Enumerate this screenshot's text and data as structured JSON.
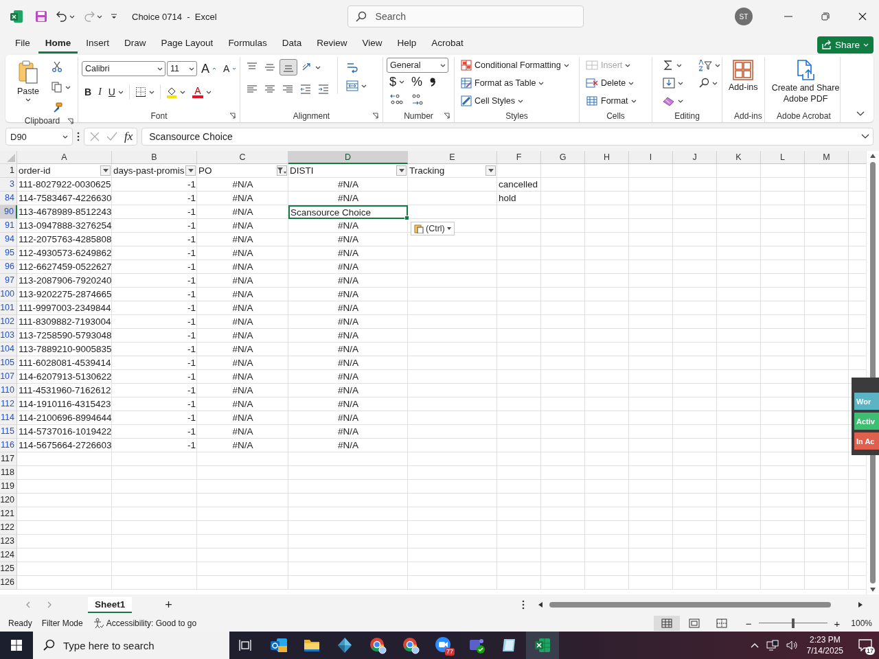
{
  "title_bar": {
    "title": "Choice 0714  -  Excel",
    "redo_disabled": true,
    "search": {
      "placeholder": "Search"
    },
    "avatar": "ST"
  },
  "ribbon_tabs": [
    {
      "label": "File",
      "selected": false
    },
    {
      "label": "Home",
      "selected": true
    },
    {
      "label": "Insert",
      "selected": false
    },
    {
      "label": "Draw",
      "selected": false
    },
    {
      "label": "Page Layout",
      "selected": false
    },
    {
      "label": "Formulas",
      "selected": false
    },
    {
      "label": "Data",
      "selected": false
    },
    {
      "label": "Review",
      "selected": false
    },
    {
      "label": "View",
      "selected": false
    },
    {
      "label": "Help",
      "selected": false
    },
    {
      "label": "Acrobat",
      "selected": false
    }
  ],
  "share_button": "Share",
  "ribbon": {
    "groups": [
      {
        "kind": "clipboard",
        "label": "Clipboard",
        "launcher": true,
        "paste_label": "Paste"
      },
      {
        "kind": "font",
        "label": "Font",
        "launcher": true,
        "font_name": "Calibri",
        "font_size": "11",
        "grow_glyph": "A",
        "shrink_glyph": "A",
        "bold": "B",
        "italic": "I",
        "underline": "U",
        "font_color_glyph": "A"
      },
      {
        "kind": "alignment",
        "label": "Alignment",
        "launcher": true,
        "vertical_align": [
          {
            "selected": false
          },
          {
            "selected": false
          },
          {
            "selected": true
          }
        ]
      },
      {
        "kind": "number",
        "label": "Number",
        "launcher": true,
        "format": "General",
        "currency": "$",
        "percent": "%"
      },
      {
        "kind": "styles",
        "label": "Styles",
        "commands": [
          "Conditional Formatting",
          "Format as Table",
          "Cell Styles"
        ]
      },
      {
        "kind": "cells",
        "label": "Cells",
        "commands": [
          {
            "label": "Insert",
            "disabled": true
          },
          {
            "label": "Delete",
            "disabled": false
          },
          {
            "label": "Format",
            "disabled": false
          }
        ]
      },
      {
        "kind": "editing",
        "label": "Editing"
      },
      {
        "kind": "addins",
        "label": "Add-ins",
        "button": "Add-ins"
      },
      {
        "kind": "acrobat",
        "label": "Adobe Acrobat",
        "button": "Create and Share Adobe PDF"
      }
    ]
  },
  "formula_bar": {
    "name_box": "D90",
    "function_label": "fx",
    "value": "Scansource Choice"
  },
  "sheet": {
    "columns": [
      {
        "label": "A",
        "selected": false
      },
      {
        "label": "B",
        "selected": false
      },
      {
        "label": "C",
        "selected": false
      },
      {
        "label": "D",
        "selected": true
      },
      {
        "label": "E",
        "selected": false
      },
      {
        "label": "F",
        "selected": false
      },
      {
        "label": "G",
        "selected": false
      },
      {
        "label": "H",
        "selected": false
      },
      {
        "label": "I",
        "selected": false
      },
      {
        "label": "J",
        "selected": false
      },
      {
        "label": "K",
        "selected": false
      },
      {
        "label": "L",
        "selected": false
      },
      {
        "label": "M",
        "selected": false
      }
    ],
    "rows": [
      {
        "number": "1",
        "filtered": false,
        "selected": false,
        "cells": {
          "a": {
            "value": "order-id",
            "kind": "text",
            "filter_applied": false
          },
          "b": {
            "value": "days-past-promis",
            "kind": "text",
            "filter_applied": false
          },
          "c": {
            "value": "PO",
            "kind": "text",
            "filter_applied": true
          },
          "d": {
            "value": "DISTI",
            "kind": "text",
            "filter_applied": false
          },
          "e": {
            "value": "Tracking",
            "kind": "text",
            "filter_applied": false
          }
        }
      },
      {
        "number": "3",
        "filtered": true,
        "selected": false,
        "cells": {
          "a": {
            "value": "111-8027922-0030625",
            "kind": "text"
          },
          "b": {
            "value": "-1",
            "kind": "number"
          },
          "c": {
            "value": "#N/A",
            "kind": "error"
          },
          "d": {
            "value": "#N/A",
            "kind": "error"
          },
          "f": {
            "value": "cancelled",
            "kind": "text"
          }
        }
      },
      {
        "number": "84",
        "filtered": true,
        "selected": false,
        "cells": {
          "a": {
            "value": "114-7583467-4226630",
            "kind": "text"
          },
          "b": {
            "value": "-1",
            "kind": "number"
          },
          "c": {
            "value": "#N/A",
            "kind": "error"
          },
          "d": {
            "value": "#N/A",
            "kind": "error"
          },
          "f": {
            "value": "hold",
            "kind": "text"
          }
        }
      },
      {
        "number": "90",
        "filtered": true,
        "selected": true,
        "cells": {
          "a": {
            "value": "113-4678989-8512243",
            "kind": "text"
          },
          "b": {
            "value": "-1",
            "kind": "number"
          },
          "c": {
            "value": "#N/A",
            "kind": "error"
          },
          "d": {
            "value": "Scansource Choice",
            "kind": "text",
            "selected": true
          }
        }
      },
      {
        "number": "91",
        "filtered": true,
        "selected": false,
        "cells": {
          "a": {
            "value": "113-0947888-3276254",
            "kind": "text"
          },
          "b": {
            "value": "-1",
            "kind": "number"
          },
          "c": {
            "value": "#N/A",
            "kind": "error"
          },
          "d": {
            "value": "#N/A",
            "kind": "error"
          }
        }
      },
      {
        "number": "94",
        "filtered": true,
        "selected": false,
        "cells": {
          "a": {
            "value": "112-2075763-4285808",
            "kind": "text"
          },
          "b": {
            "value": "-1",
            "kind": "number"
          },
          "c": {
            "value": "#N/A",
            "kind": "error"
          },
          "d": {
            "value": "#N/A",
            "kind": "error"
          }
        }
      },
      {
        "number": "95",
        "filtered": true,
        "selected": false,
        "cells": {
          "a": {
            "value": "112-4930573-6249862",
            "kind": "text"
          },
          "b": {
            "value": "-1",
            "kind": "number"
          },
          "c": {
            "value": "#N/A",
            "kind": "error"
          },
          "d": {
            "value": "#N/A",
            "kind": "error"
          }
        }
      },
      {
        "number": "96",
        "filtered": true,
        "selected": false,
        "cells": {
          "a": {
            "value": "112-6627459-0522627",
            "kind": "text"
          },
          "b": {
            "value": "-1",
            "kind": "number"
          },
          "c": {
            "value": "#N/A",
            "kind": "error"
          },
          "d": {
            "value": "#N/A",
            "kind": "error"
          }
        }
      },
      {
        "number": "97",
        "filtered": true,
        "selected": false,
        "cells": {
          "a": {
            "value": "113-2087906-7920240",
            "kind": "text"
          },
          "b": {
            "value": "-1",
            "kind": "number"
          },
          "c": {
            "value": "#N/A",
            "kind": "error"
          },
          "d": {
            "value": "#N/A",
            "kind": "error"
          }
        }
      },
      {
        "number": "100",
        "filtered": true,
        "selected": false,
        "cells": {
          "a": {
            "value": "113-9202275-2874665",
            "kind": "text"
          },
          "b": {
            "value": "-1",
            "kind": "number"
          },
          "c": {
            "value": "#N/A",
            "kind": "error"
          },
          "d": {
            "value": "#N/A",
            "kind": "error"
          }
        }
      },
      {
        "number": "101",
        "filtered": true,
        "selected": false,
        "cells": {
          "a": {
            "value": "111-9997003-2349844",
            "kind": "text"
          },
          "b": {
            "value": "-1",
            "kind": "number"
          },
          "c": {
            "value": "#N/A",
            "kind": "error"
          },
          "d": {
            "value": "#N/A",
            "kind": "error"
          }
        }
      },
      {
        "number": "102",
        "filtered": true,
        "selected": false,
        "cells": {
          "a": {
            "value": "111-8309882-7193004",
            "kind": "text"
          },
          "b": {
            "value": "-1",
            "kind": "number"
          },
          "c": {
            "value": "#N/A",
            "kind": "error"
          },
          "d": {
            "value": "#N/A",
            "kind": "error"
          }
        }
      },
      {
        "number": "103",
        "filtered": true,
        "selected": false,
        "cells": {
          "a": {
            "value": "113-7258590-5793048",
            "kind": "text"
          },
          "b": {
            "value": "-1",
            "kind": "number"
          },
          "c": {
            "value": "#N/A",
            "kind": "error"
          },
          "d": {
            "value": "#N/A",
            "kind": "error"
          }
        }
      },
      {
        "number": "104",
        "filtered": true,
        "selected": false,
        "cells": {
          "a": {
            "value": "113-7889210-9005835",
            "kind": "text"
          },
          "b": {
            "value": "-1",
            "kind": "number"
          },
          "c": {
            "value": "#N/A",
            "kind": "error"
          },
          "d": {
            "value": "#N/A",
            "kind": "error"
          }
        }
      },
      {
        "number": "105",
        "filtered": true,
        "selected": false,
        "cells": {
          "a": {
            "value": "111-6028081-4539414",
            "kind": "text"
          },
          "b": {
            "value": "-1",
            "kind": "number"
          },
          "c": {
            "value": "#N/A",
            "kind": "error"
          },
          "d": {
            "value": "#N/A",
            "kind": "error"
          }
        }
      },
      {
        "number": "107",
        "filtered": true,
        "selected": false,
        "cells": {
          "a": {
            "value": "114-6207913-5130622",
            "kind": "text"
          },
          "b": {
            "value": "-1",
            "kind": "number"
          },
          "c": {
            "value": "#N/A",
            "kind": "error"
          },
          "d": {
            "value": "#N/A",
            "kind": "error"
          }
        }
      },
      {
        "number": "110",
        "filtered": true,
        "selected": false,
        "cells": {
          "a": {
            "value": "111-4531960-7162612",
            "kind": "text"
          },
          "b": {
            "value": "-1",
            "kind": "number"
          },
          "c": {
            "value": "#N/A",
            "kind": "error"
          },
          "d": {
            "value": "#N/A",
            "kind": "error"
          }
        }
      },
      {
        "number": "112",
        "filtered": true,
        "selected": false,
        "cells": {
          "a": {
            "value": "114-1910116-4315423",
            "kind": "text"
          },
          "b": {
            "value": "-1",
            "kind": "number"
          },
          "c": {
            "value": "#N/A",
            "kind": "error"
          },
          "d": {
            "value": "#N/A",
            "kind": "error"
          }
        }
      },
      {
        "number": "114",
        "filtered": true,
        "selected": false,
        "cells": {
          "a": {
            "value": "114-2100696-8994644",
            "kind": "text"
          },
          "b": {
            "value": "-1",
            "kind": "number"
          },
          "c": {
            "value": "#N/A",
            "kind": "error"
          },
          "d": {
            "value": "#N/A",
            "kind": "error"
          }
        }
      },
      {
        "number": "115",
        "filtered": true,
        "selected": false,
        "cells": {
          "a": {
            "value": "114-5737016-1019422",
            "kind": "text"
          },
          "b": {
            "value": "-1",
            "kind": "number"
          },
          "c": {
            "value": "#N/A",
            "kind": "error"
          },
          "d": {
            "value": "#N/A",
            "kind": "error"
          }
        }
      },
      {
        "number": "116",
        "filtered": true,
        "selected": false,
        "cells": {
          "a": {
            "value": "114-5675664-2726603",
            "kind": "text"
          },
          "b": {
            "value": "-1",
            "kind": "number"
          },
          "c": {
            "value": "#N/A",
            "kind": "error"
          },
          "d": {
            "value": "#N/A",
            "kind": "error"
          }
        }
      },
      {
        "number": "117",
        "filtered": false,
        "selected": false
      },
      {
        "number": "118",
        "filtered": false,
        "selected": false
      },
      {
        "number": "119",
        "filtered": false,
        "selected": false
      },
      {
        "number": "120",
        "filtered": false,
        "selected": false
      },
      {
        "number": "121",
        "filtered": false,
        "selected": false
      },
      {
        "number": "122",
        "filtered": false,
        "selected": false
      },
      {
        "number": "123",
        "filtered": false,
        "selected": false
      },
      {
        "number": "124",
        "filtered": false,
        "selected": false
      },
      {
        "number": "125",
        "filtered": false,
        "selected": false
      },
      {
        "number": "126",
        "filtered": false,
        "selected": false
      }
    ]
  },
  "paste_options": {
    "label": "(Ctrl)"
  },
  "side_panel": {
    "buttons": [
      {
        "label": "Wor",
        "color": "#5ab4c4"
      },
      {
        "label": "Activ",
        "color": "#3dbf72"
      },
      {
        "label": "In Ac",
        "color": "#e0604f"
      }
    ]
  },
  "sheet_tabs": [
    {
      "label": "Sheet1",
      "selected": true
    }
  ],
  "new_sheet": "+",
  "status_bar": {
    "ready": "Ready",
    "filter_mode": "Filter Mode",
    "accessibility": "Accessibility: Good to go",
    "views": [
      {
        "selected": true
      },
      {
        "selected": false
      },
      {
        "selected": false
      }
    ],
    "zoom_out": "−",
    "zoom_in": "+",
    "zoom": {
      "level": 0.5
    },
    "zoom_label": "100%"
  },
  "taskbar": {
    "search_placeholder": "Type here to search",
    "apps": [
      {
        "kind": "mail",
        "active": false
      },
      {
        "kind": "folder",
        "active": false
      },
      {
        "kind": "gem",
        "active": false
      },
      {
        "kind": "browser",
        "active": false
      },
      {
        "kind": "browser",
        "active": false
      },
      {
        "kind": "video",
        "active": false,
        "badge": "77"
      },
      {
        "kind": "chat",
        "active": false
      },
      {
        "kind": "notes",
        "active": false
      },
      {
        "kind": "spreadsheet",
        "active": true
      }
    ],
    "time": "2:23 PM",
    "date": "7/14/2025",
    "notifications": "17"
  }
}
